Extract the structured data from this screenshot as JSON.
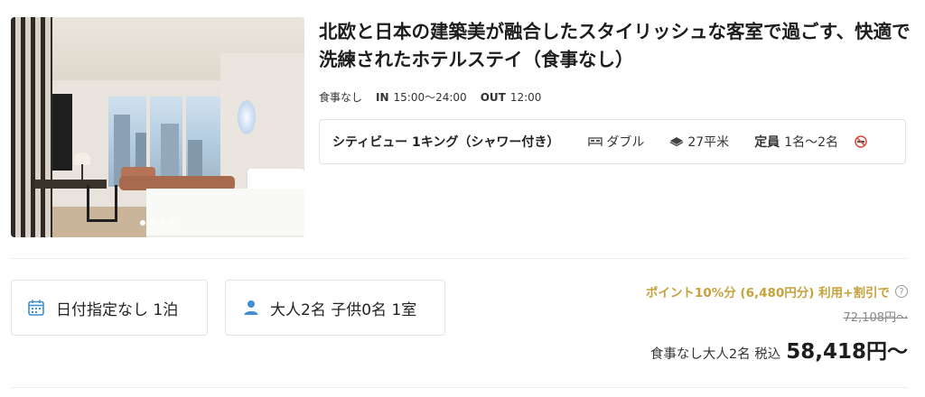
{
  "hotel": {
    "title": "北欧と日本の建築美が融合したスタイリッシュな客室で過ごす、快適で洗練されたホテルステイ（食事なし）",
    "meal_plan": "食事なし",
    "checkin_label": "IN",
    "checkin_time": "15:00〜24:00",
    "checkout_label": "OUT",
    "checkout_time": "12:00",
    "photo_count": 4,
    "photo_active_index": 0
  },
  "room": {
    "name": "シティビュー 1キング（シャワー付き）",
    "bed_type": "ダブル",
    "bed_icon": "bed-icon",
    "size": "27平米",
    "size_icon": "floor-area-icon",
    "capacity_label": "定員",
    "capacity_value": "1名〜2名",
    "smoking_icon": "no-smoking-icon"
  },
  "search": {
    "date_icon": "calendar-icon",
    "date_text": "日付指定なし 1泊",
    "guests_icon": "person-icon",
    "guests_text": "大人2名 子供0名 1室"
  },
  "pricing": {
    "points_text": "ポイント10%分 (6,480円分) 利用+割引で",
    "help_icon": "question-circle-icon",
    "help_glyph": "?",
    "original_price": "72,108円〜",
    "price_label": "食事なし大人2名 税込",
    "price": "58,418円〜",
    "points_color": "#c6a23c"
  }
}
